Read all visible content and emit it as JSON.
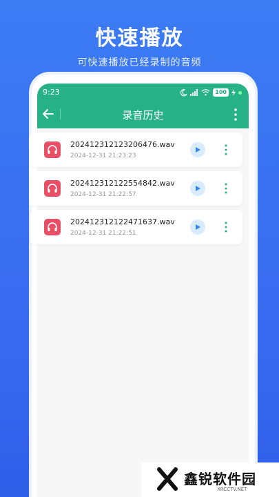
{
  "promo": {
    "title": "快速播放",
    "subtitle": "可快速播放已经录制的音频"
  },
  "status_bar": {
    "time": "9:23",
    "battery": "100",
    "icons": [
      "moon-icon",
      "signal-icon",
      "wifi-icon",
      "battery-icon",
      "charging-icon"
    ]
  },
  "navbar": {
    "title": "录音历史",
    "back_icon": "arrow-left-icon",
    "more_icon": "more-vertical-icon"
  },
  "recordings": [
    {
      "name": "20241231212320​6476.wav",
      "date": "2024-12-31 21:23:23"
    },
    {
      "name": "20241231212255​4842.wav",
      "date": "2024-12-31 21:22:57"
    },
    {
      "name": "20241231212247​1637.wav",
      "date": "2024-12-31 21:22:51"
    }
  ],
  "watermark": {
    "name": "鑫锐软件园",
    "site": "XRCCTV.NET"
  },
  "colors": {
    "background": "#3a6cf1",
    "header": "#27b187",
    "file_icon": "#ea4e66",
    "play_bg": "#d9ebff",
    "play_icon": "#2f86e8"
  }
}
